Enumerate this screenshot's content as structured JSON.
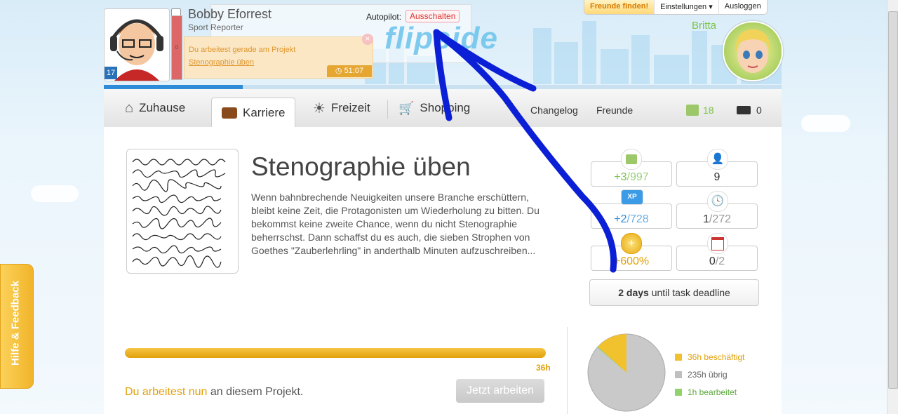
{
  "topnav": {
    "find_friends": "Freunde finden!",
    "settings": "Einstellungen ▾",
    "logout": "Ausloggen"
  },
  "character": {
    "name": "Bobby Eforrest",
    "job": "Sport Reporter",
    "level": "17",
    "energy": "0"
  },
  "autopilot": {
    "label": "Autopilot:",
    "button": "Ausschalten"
  },
  "project_notice": {
    "line1": "Du arbeitest gerade am Projekt",
    "link": "Stenographie üben",
    "timer": "51:07",
    "close": "×"
  },
  "logo": "flipside",
  "partner": {
    "name": "Britta"
  },
  "nav": {
    "home": "Zuhause",
    "career": "Karriere",
    "leisure": "Freizeit",
    "shopping": "Shopping",
    "changelog": "Changelog",
    "friends": "Freunde",
    "money": "18",
    "tickets": "0"
  },
  "task": {
    "title": "Stenographie üben",
    "description": "Wenn bahnbrechende Neuigkeiten unsere Branche erschüttern, bleibt keine Zeit, die Protagonisten um Wiederholung zu bitten. Du bekommst keine zweite Chance, wenn du nicht Stenographie beherrschst. Dann schaffst du es auch, die sieben Strophen von Goethes \"Zauberlehrling\" in anderthalb Minuten aufzuschreiben..."
  },
  "stats": {
    "money_gain": "+3",
    "money_total": "/997",
    "persons": "9",
    "xp_gain": "+2",
    "xp_total": "/728",
    "time_current": "1",
    "time_total": "/272",
    "bonus": "+600%",
    "calendar_current": "0",
    "calendar_total": "/2",
    "xp_badge": "XP"
  },
  "deadline": {
    "value": "2 days",
    "text": " until task deadline"
  },
  "work": {
    "hours": "36h",
    "progress": 1.0,
    "status_hl": "Du arbeitest nun",
    "status_rest": " an diesem Projekt.",
    "button": "Jetzt arbeiten"
  },
  "pie": {
    "legend": [
      {
        "label": "36h beschäftigt",
        "color": "#f2c12e"
      },
      {
        "label": "235h übrig",
        "color": "#bfbfbf"
      },
      {
        "label": "1h bearbeitet",
        "color": "#8fd36a"
      }
    ],
    "busy_fraction": 0.133,
    "done_fraction": 0.0037
  },
  "feedback": "Hilfe & Feedback",
  "colors": {
    "accent": "#e1a10a",
    "blue": "#2d8bd8",
    "green": "#7cc34a",
    "annotation": "#0b1fd6"
  }
}
